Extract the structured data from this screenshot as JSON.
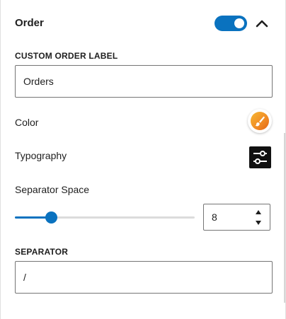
{
  "panel": {
    "title": "Order",
    "toggle_state": "on",
    "accent_color": "#0a72bf"
  },
  "custom_order_label": {
    "label": "CUSTOM ORDER LABEL",
    "value": "Orders"
  },
  "color": {
    "label": "Color",
    "icon": "paintbrush-icon",
    "swatch_color": "#f08a24"
  },
  "typography": {
    "label": "Typography",
    "icon": "sliders-icon"
  },
  "separator_space": {
    "label": "Separator Space",
    "value": "8",
    "slider_fraction": 0.2
  },
  "separator": {
    "label": "SEPARATOR",
    "value": "/"
  }
}
